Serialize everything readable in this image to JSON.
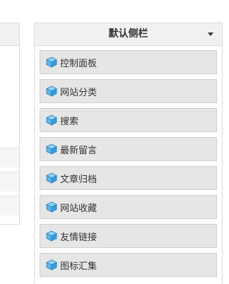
{
  "sidebar": {
    "title": "默认侧栏",
    "dropdown_icon": "caret-down-icon",
    "item_icon": "cube-icon",
    "items": [
      {
        "label": "控制面板"
      },
      {
        "label": "网站分类"
      },
      {
        "label": "搜索"
      },
      {
        "label": "最新留言"
      },
      {
        "label": "文章归档"
      },
      {
        "label": "网站收藏"
      },
      {
        "label": "友情链接"
      },
      {
        "label": "图标汇集"
      }
    ]
  },
  "colors": {
    "header_bg": "#f1f1f1",
    "item_bg": "#e6e6e6",
    "border": "#dcdcdc",
    "icon_top": "#8fd3f4",
    "icon_side": "#3a9bd8"
  }
}
